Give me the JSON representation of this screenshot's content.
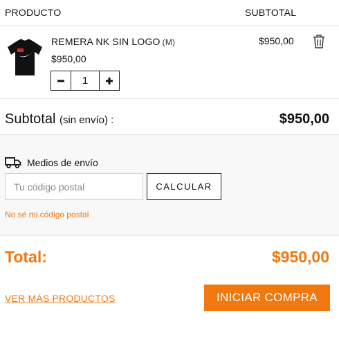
{
  "table_header": {
    "product": "PRODUCTO",
    "subtotal": "SUBTOTAL"
  },
  "cart_item": {
    "name": "REMERA NK SIN LOGO",
    "variant": "(M)",
    "unit_price": "$950,00",
    "quantity": "1",
    "subtotal": "$950,00",
    "image_icon": "black-tshirt-image",
    "decrease_icon": "minus-icon",
    "increase_icon": "plus-icon",
    "remove_icon": "trash-icon"
  },
  "subtotal": {
    "label": "Subtotal",
    "note": "(sin envío) :",
    "value": "$950,00"
  },
  "shipping": {
    "icon": "truck-icon",
    "title": "Medios de envío",
    "postal_code_placeholder": "Tu código postal",
    "postal_code_value": "",
    "calculate_label": "CALCULAR",
    "unknown_postal_code_link": "No sé mi código postal"
  },
  "total": {
    "label": "Total:",
    "value": "$950,00"
  },
  "actions": {
    "more_products_link": "VER MÁS PRODUCTOS",
    "start_purchase_button": "INICIAR COMPRA"
  },
  "colors": {
    "accent": "#f0780f",
    "text": "#111111",
    "divider": "#e6e6e6",
    "shipping_background": "#f8f8f8"
  }
}
